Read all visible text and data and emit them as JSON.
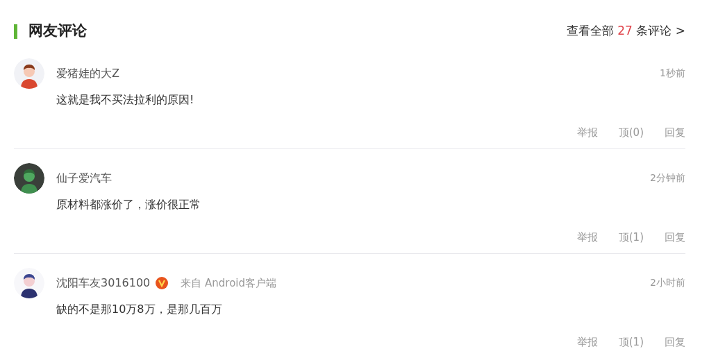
{
  "header": {
    "title": "网友评论",
    "view_all": {
      "prefix": "查看全部",
      "count": "27",
      "suffix": "条评论 >"
    }
  },
  "comments": [
    {
      "user": "爱猪娃的大Z",
      "verified": false,
      "time": "1秒前",
      "text": "这就是我不买法拉利的原因!",
      "actions": [
        "举报",
        "顶(0)",
        "回复"
      ]
    },
    {
      "user": "仙子爱汽车",
      "verified": false,
      "time": "2分钟前",
      "text": "原材料都涨价了，涨价很正常",
      "actions": [
        "举报",
        "顶(1)",
        "回复"
      ]
    },
    {
      "user": "沈阳车友3016100",
      "verified": true,
      "source": "来自 Android客户端",
      "time": "2小时前",
      "text": "缺的不是那10万8万，是那几百万",
      "actions": [
        "举报",
        "顶(1)",
        "回复"
      ]
    }
  ]
}
